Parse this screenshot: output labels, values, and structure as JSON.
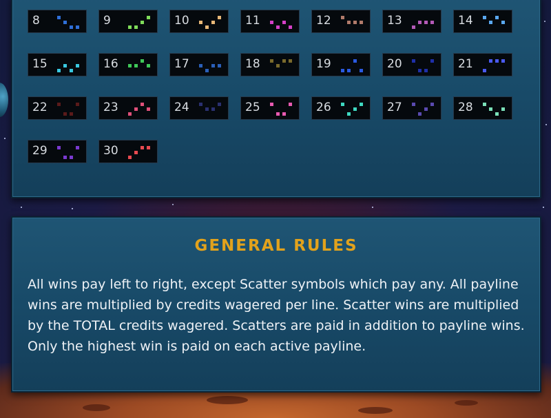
{
  "paylines": [
    {
      "number": "8",
      "color": "#2f6fd8",
      "pattern": [
        0,
        1,
        2,
        2
      ]
    },
    {
      "number": "9",
      "color": "#7fdc5a",
      "pattern": [
        2,
        2,
        1,
        0
      ]
    },
    {
      "number": "10",
      "color": "#e8b878",
      "pattern": [
        1,
        2,
        1,
        0
      ]
    },
    {
      "number": "11",
      "color": "#d640c8",
      "pattern": [
        1,
        2,
        1,
        2
      ]
    },
    {
      "number": "12",
      "color": "#b07a6a",
      "pattern": [
        0,
        1,
        1,
        1
      ]
    },
    {
      "number": "13",
      "color": "#b45ab8",
      "pattern": [
        2,
        1,
        1,
        1
      ]
    },
    {
      "number": "14",
      "color": "#5aa8f0",
      "pattern": [
        0,
        1,
        0,
        1
      ]
    },
    {
      "number": "15",
      "color": "#39c8e0",
      "pattern": [
        2,
        1,
        2,
        1
      ]
    },
    {
      "number": "16",
      "color": "#3fc858",
      "pattern": [
        1,
        1,
        0,
        1
      ]
    },
    {
      "number": "17",
      "color": "#2a5fb8",
      "pattern": [
        1,
        2,
        1,
        1
      ]
    },
    {
      "number": "18",
      "color": "#7a6a2c",
      "pattern": [
        0,
        1,
        0,
        0
      ]
    },
    {
      "number": "19",
      "color": "#2a5ae0",
      "pattern": [
        2,
        2,
        0,
        2
      ]
    },
    {
      "number": "20",
      "color": "#1f2fa8",
      "pattern": [
        0,
        2,
        2,
        0
      ]
    },
    {
      "number": "21",
      "color": "#4a5af0",
      "pattern": [
        2,
        0,
        0,
        0
      ]
    },
    {
      "number": "22",
      "color": "#5a1a1a",
      "pattern": [
        0,
        2,
        2,
        0
      ]
    },
    {
      "number": "23",
      "color": "#e0507a",
      "pattern": [
        2,
        1,
        0,
        1
      ]
    },
    {
      "number": "24",
      "color": "#2a3070",
      "pattern": [
        0,
        1,
        1,
        0
      ]
    },
    {
      "number": "25",
      "color": "#e85ab0",
      "pattern": [
        0,
        2,
        2,
        0
      ]
    },
    {
      "number": "26",
      "color": "#3ed8c0",
      "pattern": [
        0,
        2,
        1,
        0
      ]
    },
    {
      "number": "27",
      "color": "#5a4ab0",
      "pattern": [
        0,
        2,
        1,
        0
      ]
    },
    {
      "number": "28",
      "color": "#7ae0b8",
      "pattern": [
        0,
        1,
        2,
        1
      ]
    },
    {
      "number": "29",
      "color": "#7a3ad0",
      "pattern": [
        0,
        2,
        2,
        0
      ]
    },
    {
      "number": "30",
      "color": "#e84a50",
      "pattern": [
        2,
        1,
        0,
        0
      ]
    }
  ],
  "rules": {
    "title": "GENERAL RULES",
    "text": "All wins pay left to right, except Scatter symbols which pay any. All payline wins are multiplied by credits wagered per line. Scatter wins are multiplied by the TOTAL credits wagered. Scatters are paid in addition to payline wins. Only the highest win is paid on each active payline."
  },
  "colors": {
    "accent": "#e2a21c",
    "panel": "#1a4d6c",
    "tile": "#05090d"
  }
}
